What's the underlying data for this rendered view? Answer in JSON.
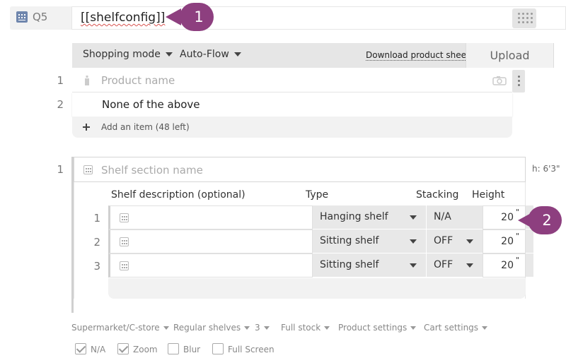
{
  "question": {
    "number": "Q5",
    "title": "[[shelfconfig]]"
  },
  "callouts": [
    "1",
    "2"
  ],
  "toolbar": {
    "mode_label": "Shopping mode",
    "flow_label": "Auto-Flow",
    "download_label": "Download product sheet",
    "upload_label": "Upload"
  },
  "products": {
    "rows": [
      {
        "num": "1",
        "placeholder": "Product name"
      },
      {
        "num": "2",
        "label": "None of the above"
      }
    ],
    "add_label": "Add an item (48 left)"
  },
  "shelf": {
    "num": "1",
    "name_placeholder": "Shelf section name",
    "height_note": "h: 6'3\"",
    "columns": {
      "description": "Shelf description (optional)",
      "type": "Type",
      "stacking": "Stacking",
      "height": "Height"
    },
    "rows": [
      {
        "num": "1",
        "type": "Hanging shelf",
        "stacking": "N/A",
        "height": "20",
        "unit": "\""
      },
      {
        "num": "2",
        "type": "Sitting shelf",
        "stacking": "OFF",
        "height": "20",
        "unit": "\""
      },
      {
        "num": "3",
        "type": "Sitting shelf",
        "stacking": "OFF",
        "height": "20",
        "unit": "\""
      }
    ]
  },
  "settings": {
    "items": [
      "Supermarket/C-store",
      "Regular shelves",
      "3",
      "Full stock",
      "Product settings",
      "Cart settings"
    ],
    "checkboxes": [
      {
        "label": "N/A",
        "checked": true
      },
      {
        "label": "Zoom",
        "checked": true
      },
      {
        "label": "Blur",
        "checked": false
      },
      {
        "label": "Full Screen",
        "checked": false
      }
    ]
  },
  "colors": {
    "callout": "#8d3f7f",
    "question_icon": "#6f86ad"
  }
}
